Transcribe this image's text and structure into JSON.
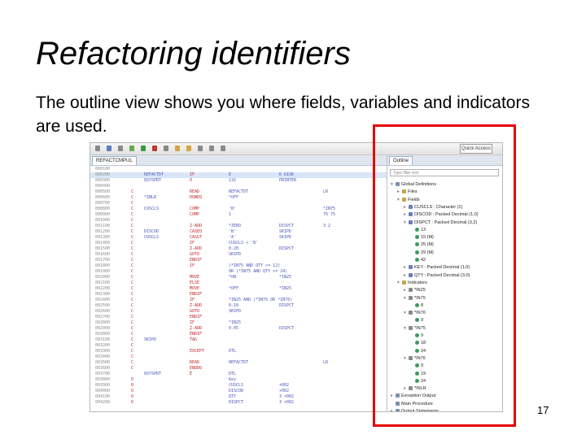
{
  "slide": {
    "title": "Refactoring identifiers",
    "subtitle": "The outline view shows you where fields, variables and indicators are used.",
    "page_number": "17",
    "highlight_color": "#e60000"
  },
  "ide": {
    "quick_access": "Quick Access",
    "editor_tab": "REFACTCMPUL",
    "outline_tab": "Outline",
    "filter_placeholder": "Type filter text"
  },
  "code_lines": [
    {
      "seq": "000100",
      "c1": "",
      "c2": "",
      "c3": "",
      "c4": "",
      "c5": "",
      "c6": ""
    },
    {
      "seq": "000200",
      "c1": "",
      "c2": "REFACTDT",
      "c3": "IF",
      "c4": "E",
      "c5": "K DISK",
      "c6": ""
    },
    {
      "seq": "000300",
      "c1": "",
      "c2": "QSYSPRT",
      "c3": "O",
      "c4": "132",
      "c5": "PRINTER",
      "c6": ""
    },
    {
      "seq": "000400",
      "c1": "",
      "c2": "",
      "c3": "",
      "c4": "",
      "c5": "",
      "c6": ""
    },
    {
      "seq": "000500",
      "c1": "C",
      "c2": "",
      "c3": "READ",
      "c4": "REFACTDT",
      "c5": "",
      "c6": "LR"
    },
    {
      "seq": "000600",
      "c1": "C",
      "c2": "*INLR",
      "c3": "DOWEQ",
      "c4": "*OFF",
      "c5": "",
      "c6": ""
    },
    {
      "seq": "000700",
      "c1": "C",
      "c2": "",
      "c3": "",
      "c4": "",
      "c5": "",
      "c6": ""
    },
    {
      "seq": "000800",
      "c1": "C",
      "c2": "CUSCLS",
      "c3": "COMP",
      "c4": "'B'",
      "c5": "",
      "c6": "*IN75"
    },
    {
      "seq": "000900",
      "c1": "C",
      "c2": "",
      "c3": "COMP",
      "c4": "1",
      "c5": "",
      "c6": "76 75"
    },
    {
      "seq": "001000",
      "c1": "C",
      "c2": "",
      "c3": "",
      "c4": "",
      "c5": "",
      "c6": ""
    },
    {
      "seq": "001100",
      "c1": "C",
      "c2": "",
      "c3": "Z-ADD",
      "c4": "*ZERO",
      "c5": "DISPCT",
      "c6": "3 2"
    },
    {
      "seq": "001200",
      "c1": "C",
      "c2": "DISCOD",
      "c3": "CASEQ",
      "c4": "'B'",
      "c5": "SKIPD",
      "c6": ""
    },
    {
      "seq": "001300",
      "c1": "C",
      "c2": "CUSCLS",
      "c3": "CASGT",
      "c4": "'A'",
      "c5": "SKIPD",
      "c6": ""
    },
    {
      "seq": "001400",
      "c1": "C",
      "c2": "",
      "c3": "IF",
      "c4": "CUSCLS < 'B'",
      "c5": "",
      "c6": ""
    },
    {
      "seq": "001500",
      "c1": "C",
      "c2": "",
      "c3": "Z-ADD",
      "c4": "0.20",
      "c5": "DISPCT",
      "c6": ""
    },
    {
      "seq": "001600",
      "c1": "C",
      "c2": "",
      "c3": "GOTO",
      "c4": "SKIPD",
      "c5": "",
      "c6": ""
    },
    {
      "seq": "001700",
      "c1": "C",
      "c2": "",
      "c3": "ENDIF",
      "c4": "",
      "c5": "",
      "c6": ""
    },
    {
      "seq": "001800",
      "c1": "C",
      "c2": "",
      "c3": "IF",
      "c4": "(*IN75 AND QTY >= 12)",
      "c5": "",
      "c6": ""
    },
    {
      "seq": "001900",
      "c1": "C",
      "c2": "",
      "c3": "",
      "c4": "OR (*IN75 AND QTY >= 24)",
      "c5": "",
      "c6": ""
    },
    {
      "seq": "002000",
      "c1": "C",
      "c2": "",
      "c3": "MOVE",
      "c4": "*ON",
      "c5": "*IN25",
      "c6": ""
    },
    {
      "seq": "002100",
      "c1": "C",
      "c2": "",
      "c3": "ELSE",
      "c4": "",
      "c5": "",
      "c6": ""
    },
    {
      "seq": "002200",
      "c1": "C",
      "c2": "",
      "c3": "MOVE",
      "c4": "*OFF",
      "c5": "*IN25",
      "c6": ""
    },
    {
      "seq": "002300",
      "c1": "C",
      "c2": "",
      "c3": "ENDIF",
      "c4": "",
      "c5": "",
      "c6": ""
    },
    {
      "seq": "002400",
      "c1": "C",
      "c2": "",
      "c3": "IF",
      "c4": "*IN25 AND (*IN75 OR *IN76)",
      "c5": "",
      "c6": ""
    },
    {
      "seq": "002500",
      "c1": "C",
      "c2": "",
      "c3": "Z-ADD",
      "c4": "0.10",
      "c5": "DISPCT",
      "c6": ""
    },
    {
      "seq": "002600",
      "c1": "C",
      "c2": "",
      "c3": "GOTO",
      "c4": "SKIPD",
      "c5": "",
      "c6": ""
    },
    {
      "seq": "002700",
      "c1": "C",
      "c2": "",
      "c3": "ENDIF",
      "c4": "",
      "c5": "",
      "c6": ""
    },
    {
      "seq": "002800",
      "c1": "C",
      "c2": "",
      "c3": "IF",
      "c4": "*IN25",
      "c5": "",
      "c6": ""
    },
    {
      "seq": "002900",
      "c1": "C",
      "c2": "",
      "c3": "Z-ADD",
      "c4": "0.05",
      "c5": "DISPCT",
      "c6": ""
    },
    {
      "seq": "003000",
      "c1": "C",
      "c2": "",
      "c3": "ENDIF",
      "c4": "",
      "c5": "",
      "c6": ""
    },
    {
      "seq": "003100",
      "c1": "C",
      "c2": "SKIPD",
      "c3": "TAG",
      "c4": "",
      "c5": "",
      "c6": ""
    },
    {
      "seq": "003200",
      "c1": "C",
      "c2": "",
      "c3": "",
      "c4": "",
      "c5": "",
      "c6": ""
    },
    {
      "seq": "003300",
      "c1": "C",
      "c2": "",
      "c3": "EXCEPT",
      "c4": "DTL",
      "c5": "",
      "c6": ""
    },
    {
      "seq": "003400",
      "c1": "C",
      "c2": "",
      "c3": "",
      "c4": "",
      "c5": "",
      "c6": ""
    },
    {
      "seq": "003500",
      "c1": "C",
      "c2": "",
      "c3": "READ",
      "c4": "REFACTDT",
      "c5": "",
      "c6": "LR"
    },
    {
      "seq": "003600",
      "c1": "C",
      "c2": "",
      "c3": "ENDDO",
      "c4": "",
      "c5": "",
      "c6": ""
    },
    {
      "seq": "003700",
      "c1": "",
      "c2": "QSYSPRT",
      "c3": "E",
      "c4": "DTL",
      "c5": "",
      "c6": ""
    },
    {
      "seq": "003800",
      "c1": "O",
      "c2": "",
      "c3": "",
      "c4": "Key",
      "c5": "",
      "c6": ""
    },
    {
      "seq": "003900",
      "c1": "O",
      "c2": "",
      "c3": "",
      "c4": "CUSCLS",
      "c5": "+002",
      "c6": ""
    },
    {
      "seq": "004000",
      "c1": "O",
      "c2": "",
      "c3": "",
      "c4": "DISCOD",
      "c5": "+002",
      "c6": ""
    },
    {
      "seq": "004100",
      "c1": "O",
      "c2": "",
      "c3": "",
      "c4": "QTY",
      "c5": "3 +002",
      "c6": ""
    },
    {
      "seq": "004200",
      "c1": "O",
      "c2": "",
      "c3": "",
      "c4": "DISPCT",
      "c5": "3 +002",
      "c6": ""
    }
  ],
  "outline": [
    {
      "label": "Global Definitions",
      "indent": 1,
      "twisty": "v",
      "color": "#7a8fb0"
    },
    {
      "label": "Files",
      "indent": 2,
      "twisty": ">",
      "color": "#c9a24a"
    },
    {
      "label": "Fields",
      "indent": 2,
      "twisty": "v",
      "color": "#c9a24a"
    },
    {
      "label": "CUSCLS : Character (1)",
      "indent": 3,
      "twisty": ">",
      "color": "#6a7fb8"
    },
    {
      "label": "DISCOD : Packed Decimal (1,0)",
      "indent": 3,
      "twisty": ">",
      "color": "#6a7fb8"
    },
    {
      "label": "DISPCT : Packed Decimal (3,2)",
      "indent": 3,
      "twisty": "v",
      "color": "#6a7fb8"
    },
    {
      "label": "13",
      "indent": 4,
      "twisty": "",
      "color": "#3c9a5f"
    },
    {
      "label": "15 (M)",
      "indent": 4,
      "twisty": "",
      "color": "#3c9a5f"
    },
    {
      "label": "25 (M)",
      "indent": 4,
      "twisty": "",
      "color": "#3c9a5f"
    },
    {
      "label": "29 (M)",
      "indent": 4,
      "twisty": "",
      "color": "#3c9a5f"
    },
    {
      "label": "42",
      "indent": 4,
      "twisty": "",
      "color": "#3c9a5f"
    },
    {
      "label": "KEY : Packed Decimal (1,0)",
      "indent": 3,
      "twisty": ">",
      "color": "#6a7fb8"
    },
    {
      "label": "QTY : Packed Decimal (3,0)",
      "indent": 3,
      "twisty": ">",
      "color": "#6a7fb8"
    },
    {
      "label": "Indicators",
      "indent": 2,
      "twisty": "v",
      "color": "#c9a24a"
    },
    {
      "label": "*IN25",
      "indent": 3,
      "twisty": ">",
      "color": "#8a8a8a"
    },
    {
      "label": "*IN75",
      "indent": 3,
      "twisty": "v",
      "color": "#8a8a8a"
    },
    {
      "label": "8",
      "indent": 4,
      "twisty": "",
      "color": "#3c9a5f"
    },
    {
      "label": "*IN76",
      "indent": 3,
      "twisty": "v",
      "color": "#8a8a8a"
    },
    {
      "label": "9",
      "indent": 4,
      "twisty": "",
      "color": "#3c9a5f"
    },
    {
      "label": "*IN75",
      "indent": 3,
      "twisty": "v",
      "color": "#8a8a8a"
    },
    {
      "label": "9",
      "indent": 4,
      "twisty": "",
      "color": "#3c9a5f"
    },
    {
      "label": "18",
      "indent": 4,
      "twisty": "",
      "color": "#3c9a5f"
    },
    {
      "label": "24",
      "indent": 4,
      "twisty": "",
      "color": "#3c9a5f"
    },
    {
      "label": "*IN76",
      "indent": 3,
      "twisty": "v",
      "color": "#8a8a8a"
    },
    {
      "label": "9",
      "indent": 4,
      "twisty": "",
      "color": "#3c9a5f"
    },
    {
      "label": "19",
      "indent": 4,
      "twisty": "",
      "color": "#3c9a5f"
    },
    {
      "label": "24",
      "indent": 4,
      "twisty": "",
      "color": "#3c9a5f"
    },
    {
      "label": "*INLR",
      "indent": 3,
      "twisty": ">",
      "color": "#8a8a8a"
    },
    {
      "label": "Exception Output",
      "indent": 1,
      "twisty": ">",
      "color": "#7a8fb0"
    },
    {
      "label": "Main Procedure",
      "indent": 1,
      "twisty": "",
      "color": "#7a8fb0"
    },
    {
      "label": "Output Statements",
      "indent": 1,
      "twisty": ">",
      "color": "#7a8fb0"
    }
  ],
  "toolbar_icons": [
    {
      "name": "new-icon",
      "color": "#8a8a8a"
    },
    {
      "name": "save-icon",
      "color": "#5b7fb8"
    },
    {
      "name": "print-icon",
      "color": "#8a8a8a"
    },
    {
      "name": "debug-icon",
      "color": "#6aa84f"
    },
    {
      "name": "run-icon",
      "color": "#3c9a3c"
    },
    {
      "name": "external-tools-icon",
      "color": "#c0392b"
    },
    {
      "name": "search-icon",
      "color": "#8a8a8a"
    },
    {
      "name": "next-annotation-icon",
      "color": "#d9a441"
    },
    {
      "name": "prev-annotation-icon",
      "color": "#d9a441"
    },
    {
      "name": "back-icon",
      "color": "#8a8a8a"
    },
    {
      "name": "forward-icon",
      "color": "#8a8a8a"
    },
    {
      "name": "open-perspective-icon",
      "color": "#8a8a8a"
    }
  ]
}
